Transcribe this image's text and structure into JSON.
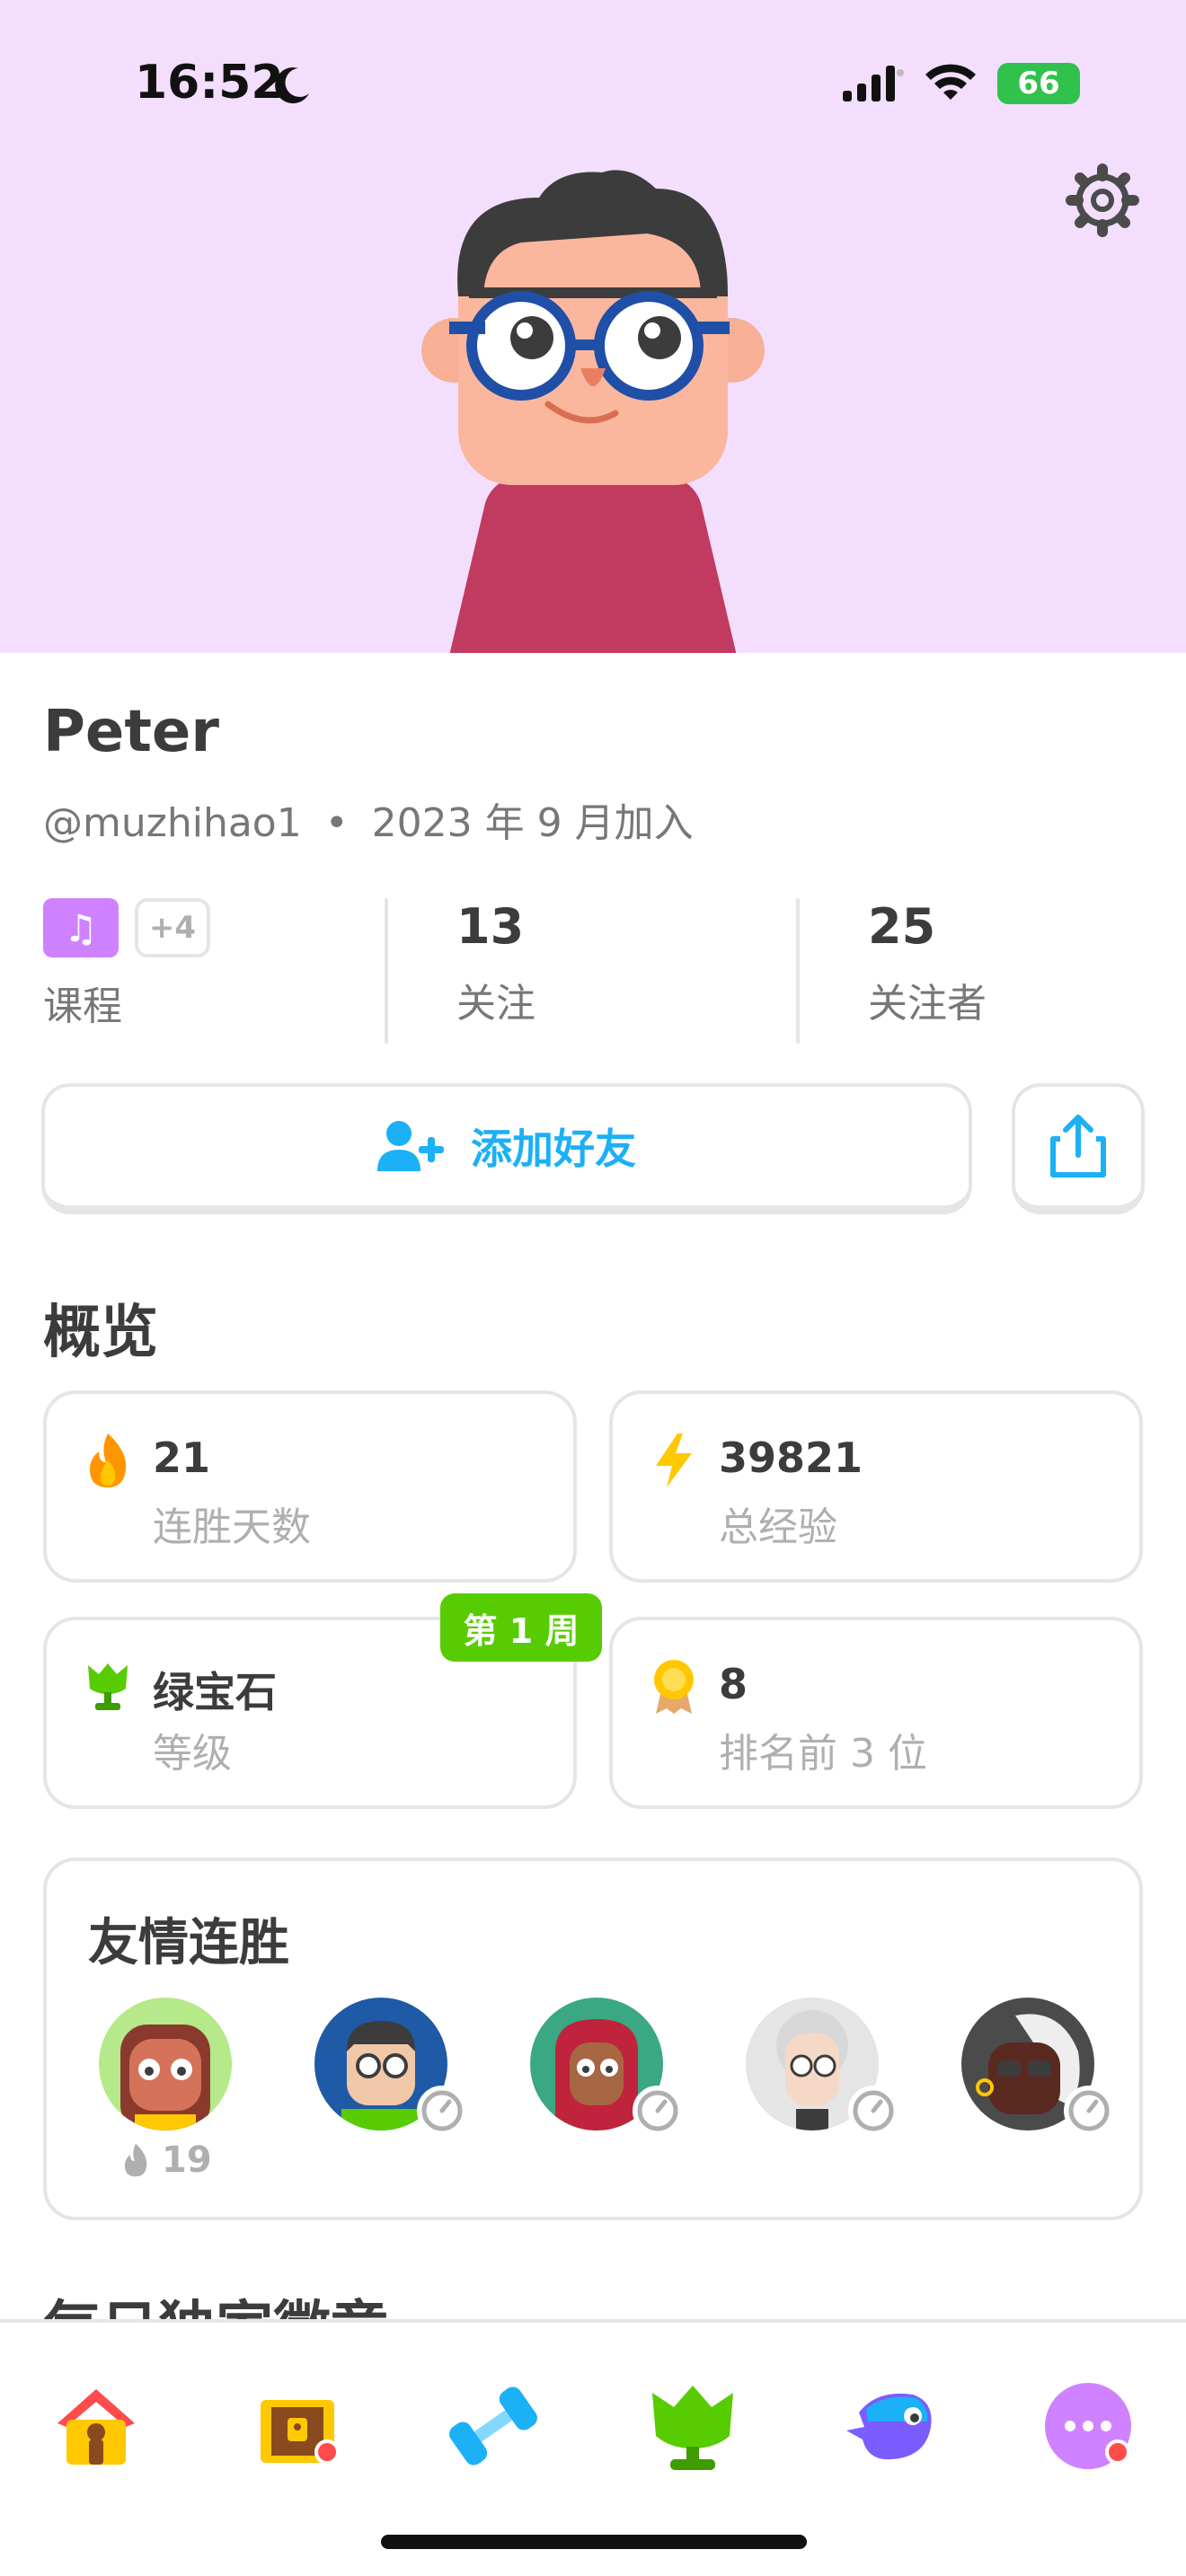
{
  "status_bar": {
    "time": "16:52",
    "battery": "66"
  },
  "profile": {
    "name": "Peter",
    "username": "@muzhihao1",
    "separator": "•",
    "joined": "2023 年 9 月加入"
  },
  "stats": {
    "courses_extra": "+4",
    "courses_label": "课程",
    "following_value": "13",
    "following_label": "关注",
    "followers_value": "25",
    "followers_label": "关注者"
  },
  "actions": {
    "add_friend_label": "添加好友"
  },
  "overview": {
    "title": "概览",
    "streak_value": "21",
    "streak_label": "连胜天数",
    "xp_value": "39821",
    "xp_label": "总经验",
    "league_value": "绿宝石",
    "league_label": "等级",
    "week_badge": "第 1 周",
    "top3_value": "8",
    "top3_label": "排名前 3 位"
  },
  "friend_streaks": {
    "title": "友情连胜",
    "first_streak": "19"
  },
  "next_section_title": "每日独家徽章",
  "colors": {
    "header_bg": "#f3dffd",
    "accent_blue": "#1cb0f6",
    "accent_green": "#58cc02",
    "course_purple": "#ce82ff",
    "notification_red": "#ff4b4b"
  },
  "icons": [
    "moon-icon",
    "signal-icon",
    "wifi-icon",
    "battery-icon",
    "gear-icon",
    "music-flag-icon",
    "add-friend-icon",
    "share-icon",
    "fire-icon",
    "lightning-icon",
    "emerald-league-icon",
    "medal-icon",
    "home-icon",
    "chest-icon",
    "dumbbell-icon",
    "league-icon",
    "bird-icon",
    "more-icon"
  ]
}
